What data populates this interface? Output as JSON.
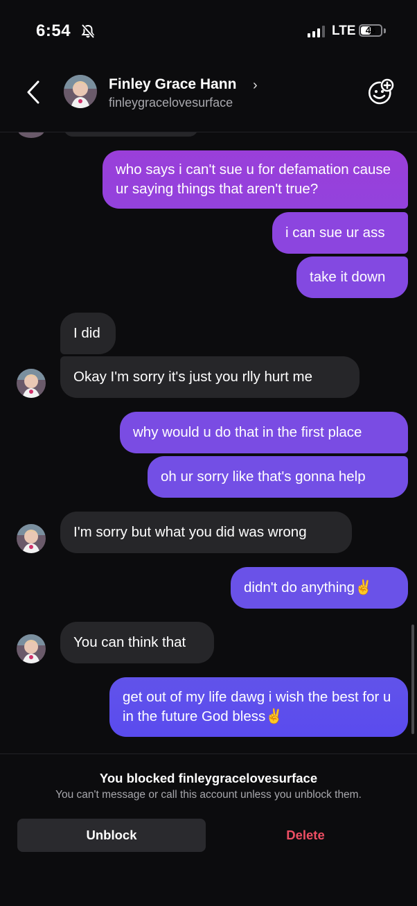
{
  "status_bar": {
    "time": "6:54",
    "network": "LTE",
    "battery": "46",
    "battery_level": 0.46
  },
  "header": {
    "name": "Finley Grace Hann",
    "username": "finleygracelovesurface",
    "chevron": "›"
  },
  "messages": [
    {
      "from": "me",
      "text": "who says i can't sue u for defamation cause ur saying things that aren't true?"
    },
    {
      "from": "me",
      "text": "i can sue ur ass"
    },
    {
      "from": "me",
      "text": "take it down"
    },
    {
      "from": "them",
      "text": "I did"
    },
    {
      "from": "them",
      "text": "Okay I'm sorry it's just you rlly hurt me"
    },
    {
      "from": "me",
      "text": "why would u do that in the first place"
    },
    {
      "from": "me",
      "text": "oh ur sorry like that's gonna help"
    },
    {
      "from": "them",
      "text": "I'm sorry but what you did was wrong"
    },
    {
      "from": "me",
      "text": "didn't do anything✌️"
    },
    {
      "from": "them",
      "text": "You can think that"
    },
    {
      "from": "me",
      "text": "get out of my life dawg i wish the best for u in the future God bless✌️"
    }
  ],
  "blocked": {
    "title": "You blocked finleygracelovesurface",
    "subtitle": "You can't message or call this account unless you unblock them.",
    "unblock_label": "Unblock",
    "delete_label": "Delete"
  },
  "colors": {
    "background": "#0c0c0e",
    "incoming_bubble": "#262629",
    "outgoing_gradient_top": "#9b3fd9",
    "outgoing_gradient_bottom": "#5c49ee",
    "delete_red": "#ee4e63"
  },
  "icons": [
    "bell-slash-icon",
    "signal-icon",
    "battery-icon",
    "back-chevron-icon",
    "add-sticker-icon"
  ]
}
